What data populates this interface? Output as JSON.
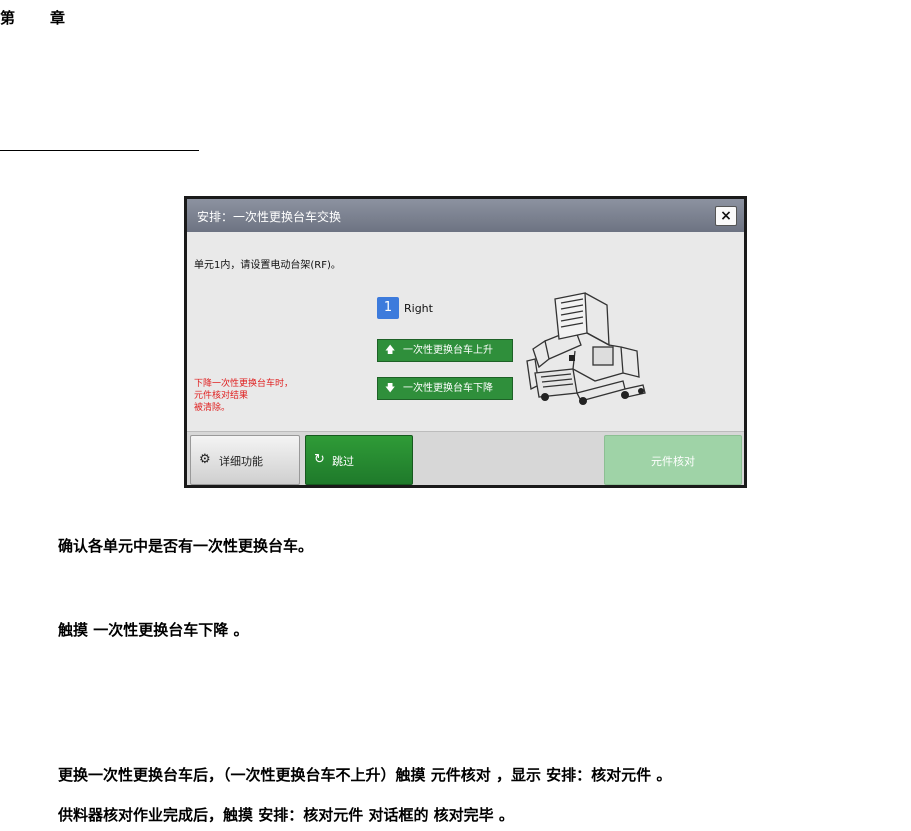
{
  "page": {
    "chapter_heading": "第　章",
    "paragraphs": [
      "确认各单元中是否有一次性更换台车。",
      "触摸 一次性更换台车下降 。",
      "更换一次性更换台车后，（一次性更换台车不上升）触摸 元件核对 ，显示 安排：核对元件 。",
      "供料器核对作业完成后，触摸 安排：核对元件 对话框的 核对完毕 。"
    ]
  },
  "dialog": {
    "title": "安排：一次性更换台车交换",
    "close_glyph": "×",
    "instruction": "单元1内，请设置电动台架(RF)。",
    "unit_number": "1",
    "unit_side": "Right",
    "raise_button": {
      "label": "一次性更换台车上升",
      "arrow": "🡅"
    },
    "lower_button": {
      "label": "一次性更换台车下降",
      "arrow": "🡇"
    },
    "warning_lines": [
      "下降一次性更换台车时，",
      "元件核对结果",
      "被清除。"
    ],
    "footer": {
      "details_label": "详细功能",
      "details_icon": "settings-doc-icon",
      "skip_label": "跳过",
      "skip_icon": "skip-arrow-icon",
      "verify_label": "元件核对"
    },
    "colors": {
      "title_bar": "#7a8090",
      "green_button": "#2f8f3b",
      "verify_disabled": "#9fd3a7",
      "warning_text": "#e02020",
      "badge": "#3d7bdc"
    }
  }
}
